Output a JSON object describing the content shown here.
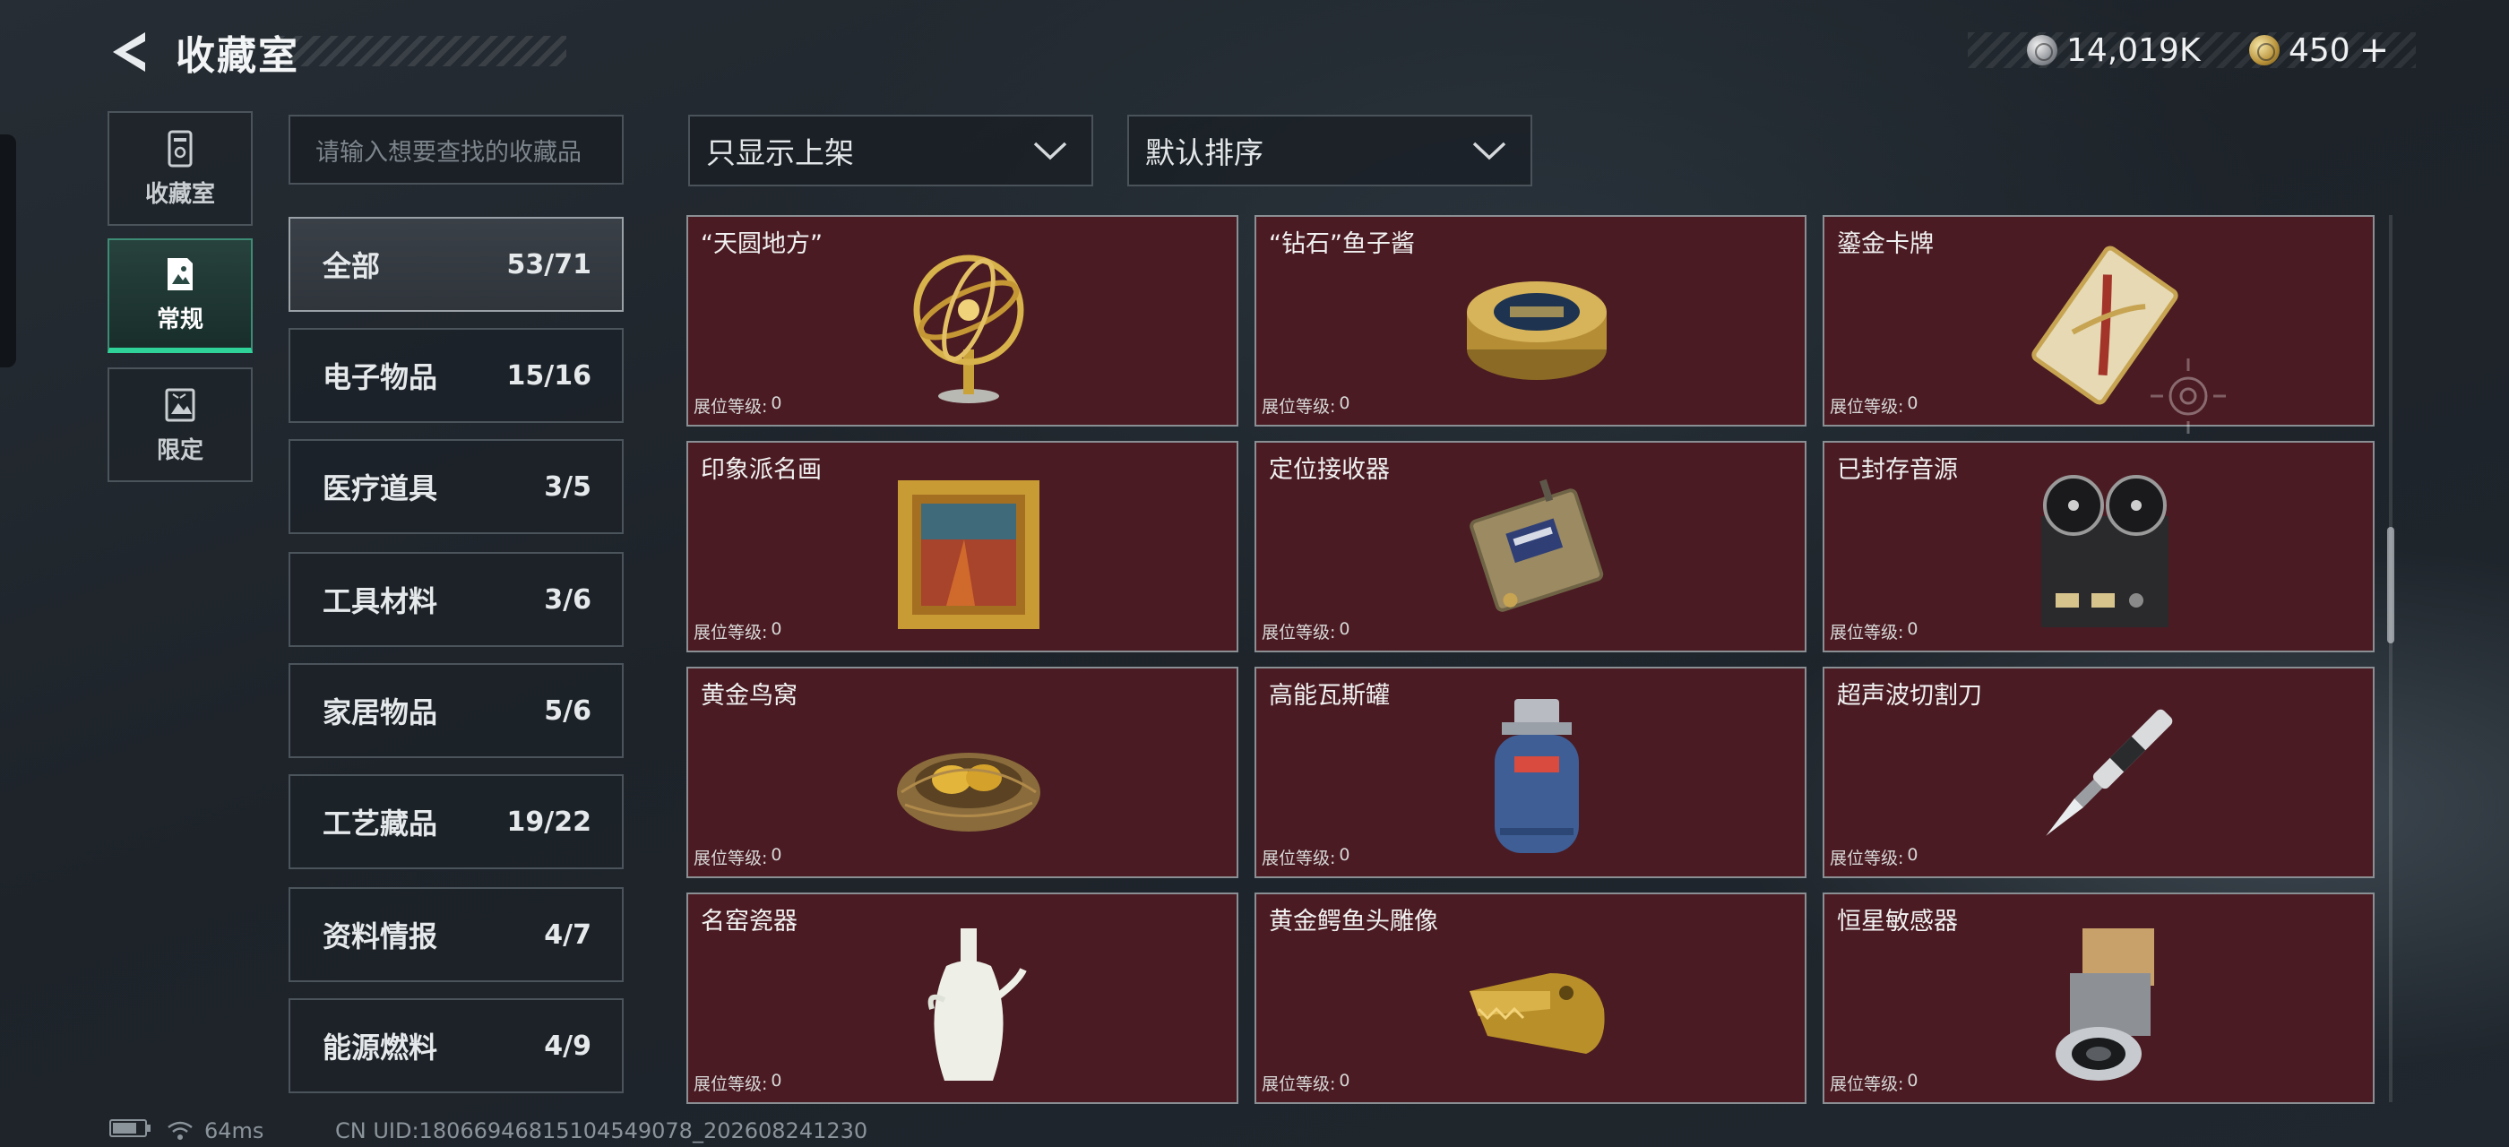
{
  "header": {
    "title": "收藏室",
    "currency": [
      {
        "icon": "silver-coin-icon",
        "value": "14,019K"
      },
      {
        "icon": "gold-coin-icon",
        "value": "450",
        "plus": "+"
      }
    ]
  },
  "nav_tabs": [
    {
      "label": "收藏室",
      "icon": "collection-room-icon",
      "active": false
    },
    {
      "label": "常规",
      "icon": "regular-icon",
      "active": true
    },
    {
      "label": "限定",
      "icon": "limited-icon",
      "active": false
    }
  ],
  "search": {
    "placeholder": "请输入想要查找的收藏品"
  },
  "filters": {
    "display_filter": "只显示上架",
    "sort": "默认排序"
  },
  "categories": [
    {
      "label": "全部",
      "count": "53/71",
      "active": true
    },
    {
      "label": "电子物品",
      "count": "15/16",
      "active": false
    },
    {
      "label": "医疗道具",
      "count": "3/5",
      "active": false
    },
    {
      "label": "工具材料",
      "count": "3/6",
      "active": false
    },
    {
      "label": "家居物品",
      "count": "5/6",
      "active": false
    },
    {
      "label": "工艺藏品",
      "count": "19/22",
      "active": false
    },
    {
      "label": "资料情报",
      "count": "4/7",
      "active": false
    },
    {
      "label": "能源燃料",
      "count": "4/9",
      "active": false
    }
  ],
  "level_label": "展位等级:",
  "items": [
    {
      "name": "“天圆地方”",
      "level": "0",
      "icon": "armillary-sphere-icon"
    },
    {
      "name": "“钻石”鱼子酱",
      "level": "0",
      "icon": "caviar-tin-icon"
    },
    {
      "name": "鎏金卡牌",
      "level": "0",
      "icon": "gilded-card-icon"
    },
    {
      "name": "印象派名画",
      "level": "0",
      "icon": "framed-painting-icon"
    },
    {
      "name": "定位接收器",
      "level": "0",
      "icon": "locator-receiver-icon"
    },
    {
      "name": "已封存音源",
      "level": "0",
      "icon": "reel-tape-recorder-icon"
    },
    {
      "name": "黄金鸟窝",
      "level": "0",
      "icon": "golden-nest-icon"
    },
    {
      "name": "高能瓦斯罐",
      "level": "0",
      "icon": "gas-canister-icon"
    },
    {
      "name": "超声波切割刀",
      "level": "0",
      "icon": "ultrasonic-cutter-icon"
    },
    {
      "name": "名窑瓷器",
      "level": "0",
      "icon": "porcelain-vase-icon"
    },
    {
      "name": "黄金鳄鱼头雕像",
      "level": "0",
      "icon": "gold-crocodile-head-icon"
    },
    {
      "name": "恒星敏感器",
      "level": "0",
      "icon": "star-sensor-icon"
    }
  ],
  "status_bar": {
    "ping": "64ms",
    "uid": "CN UID:18066946815104549078_202608241230"
  },
  "colors": {
    "card_background": "#4a1b22",
    "active_tab_accent": "#2fd39a",
    "background": "#1f252b"
  }
}
